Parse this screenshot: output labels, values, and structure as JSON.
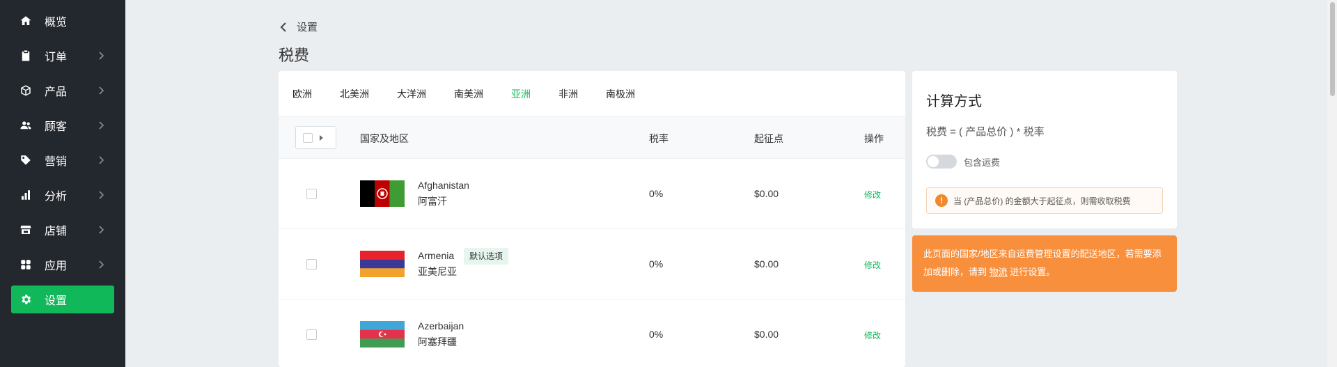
{
  "sidebar": {
    "items": [
      {
        "label": "概览",
        "icon": "home-icon"
      },
      {
        "label": "订单",
        "icon": "clipboard-icon"
      },
      {
        "label": "产品",
        "icon": "box-icon"
      },
      {
        "label": "顾客",
        "icon": "users-icon"
      },
      {
        "label": "营销",
        "icon": "tag-icon"
      },
      {
        "label": "分析",
        "icon": "bar-chart-icon"
      },
      {
        "label": "店铺",
        "icon": "store-icon"
      },
      {
        "label": "应用",
        "icon": "apps-icon"
      },
      {
        "label": "设置",
        "icon": "gear-icon"
      }
    ],
    "active_color": "#11b85a"
  },
  "header": {
    "back_label": "设置",
    "title": "税费"
  },
  "tabs": [
    "欧洲",
    "北美洲",
    "大洋洲",
    "南美洲",
    "亚洲",
    "非洲",
    "南极洲"
  ],
  "active_tab": "亚洲",
  "table": {
    "columns": {
      "country": "国家及地区",
      "rate": "税率",
      "threshold": "起征点",
      "action": "操作"
    },
    "rows": [
      {
        "name_en": "Afghanistan",
        "name_cn": "阿富汗",
        "rate": "0%",
        "threshold": "$0.00",
        "action": "修改",
        "flag": "afghanistan-flag"
      },
      {
        "name_en": "Armenia",
        "name_cn": "亚美尼亚",
        "badge": "默认选项",
        "rate": "0%",
        "threshold": "$0.00",
        "action": "修改",
        "flag": "armenia-flag"
      },
      {
        "name_en": "Azerbaijan",
        "name_cn": "阿塞拜疆",
        "rate": "0%",
        "threshold": "$0.00",
        "action": "修改",
        "flag": "azerbaijan-flag"
      }
    ]
  },
  "calc_panel": {
    "title": "计算方式",
    "formula": "税费 = ( 产品总价 ) * 税率",
    "toggle_label": "包含运费",
    "toggle_on": false,
    "warning": "当 (产品总价) 的金额大于起征点，则需收取税费"
  },
  "notice": {
    "text_before": "此页面的国家/地区来自运费管理设置的配送地区，若需要添加或删除，请到",
    "link": "物流",
    "text_after": "进行设置。",
    "color": "#f88f3d"
  }
}
